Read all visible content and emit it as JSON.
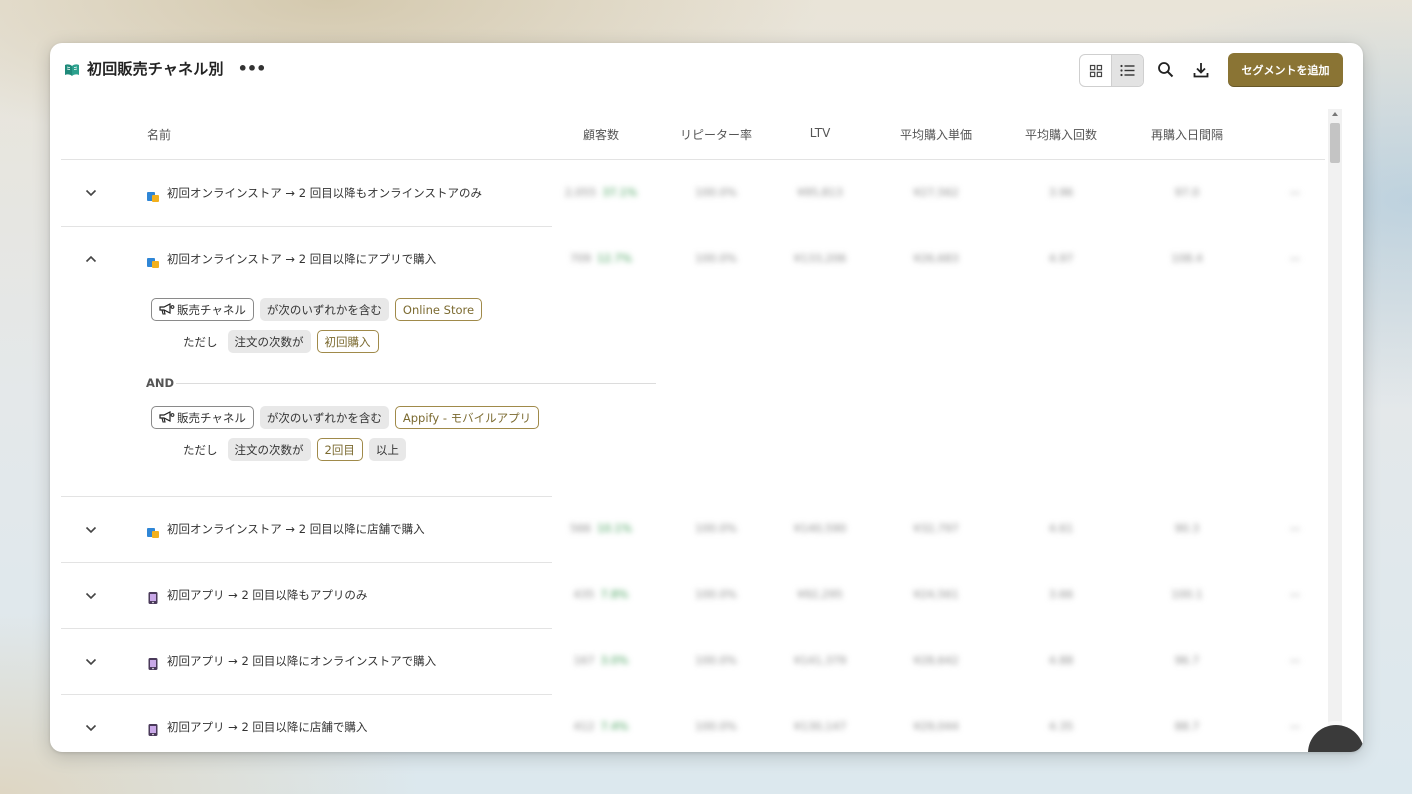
{
  "header": {
    "title": "初回販売チャネル別",
    "add_segment_label": "セグメントを追加"
  },
  "table": {
    "columns": {
      "name": "名前",
      "customers": "顧客数",
      "repeater_rate": "リピーター率",
      "ltv": "LTV",
      "avg_order_value": "平均購入単価",
      "avg_order_count": "平均購入回数",
      "repurchase_interval": "再購入日間隔"
    },
    "rows": [
      {
        "name": "初回オンラインストア → 2 回目以降もオンラインストアのみ",
        "icon": "online-store-icon",
        "expanded": false,
        "customers": "2,055",
        "customers_share": "37.1%",
        "repeater_rate": "100.0%",
        "ltv": "¥95,813",
        "avg_order_value": "¥27,562",
        "avg_order_count": "3.96",
        "repurchase_interval": "97.0",
        "extra": "—"
      },
      {
        "name": "初回オンラインストア → 2 回目以降にアプリで購入",
        "icon": "online-store-icon",
        "expanded": true,
        "customers": "709",
        "customers_share": "12.7%",
        "repeater_rate": "100.0%",
        "ltv": "¥133,206",
        "avg_order_value": "¥26,683",
        "avg_order_count": "4.97",
        "repurchase_interval": "108.4",
        "extra": "—"
      },
      {
        "name": "初回オンラインストア → 2 回目以降に店舗で購入",
        "icon": "online-store-icon",
        "expanded": false,
        "customers": "566",
        "customers_share": "10.1%",
        "repeater_rate": "100.0%",
        "ltv": "¥140,590",
        "avg_order_value": "¥32,797",
        "avg_order_count": "4.61",
        "repurchase_interval": "90.3",
        "extra": "—"
      },
      {
        "name": "初回アプリ → 2 回目以降もアプリのみ",
        "icon": "app-icon",
        "expanded": false,
        "customers": "435",
        "customers_share": "7.8%",
        "repeater_rate": "100.0%",
        "ltv": "¥92,295",
        "avg_order_value": "¥24,561",
        "avg_order_count": "3.66",
        "repurchase_interval": "100.1",
        "extra": "—"
      },
      {
        "name": "初回アプリ → 2 回目以降にオンラインストアで購入",
        "icon": "app-icon",
        "expanded": false,
        "customers": "167",
        "customers_share": "3.0%",
        "repeater_rate": "100.0%",
        "ltv": "¥141,379",
        "avg_order_value": "¥28,642",
        "avg_order_count": "4.88",
        "repurchase_interval": "96.7",
        "extra": "—"
      },
      {
        "name": "初回アプリ → 2 回目以降に店舗で購入",
        "icon": "app-icon",
        "expanded": false,
        "customers": "412",
        "customers_share": "7.4%",
        "repeater_rate": "100.0%",
        "ltv": "¥130,147",
        "avg_order_value": "¥29,044",
        "avg_order_count": "4.35",
        "repurchase_interval": "88.7",
        "extra": "—"
      }
    ]
  },
  "conditions": {
    "block1": {
      "field": "販売チャネル",
      "operator": "が次のいずれかを含む",
      "value": "Online Store",
      "tadashi": "ただし",
      "sub_field": "注文の次数が",
      "sub_value": "初回購入"
    },
    "and_label": "AND",
    "block2": {
      "field": "販売チャネル",
      "operator": "が次のいずれかを含む",
      "value": "Appify - モバイルアプリ",
      "tadashi": "ただし",
      "sub_field": "注文の次数が",
      "sub_value": "2回目",
      "sub_suffix": "以上"
    }
  },
  "colors": {
    "accent": "#8a7434",
    "positive": "#3a9a52"
  }
}
